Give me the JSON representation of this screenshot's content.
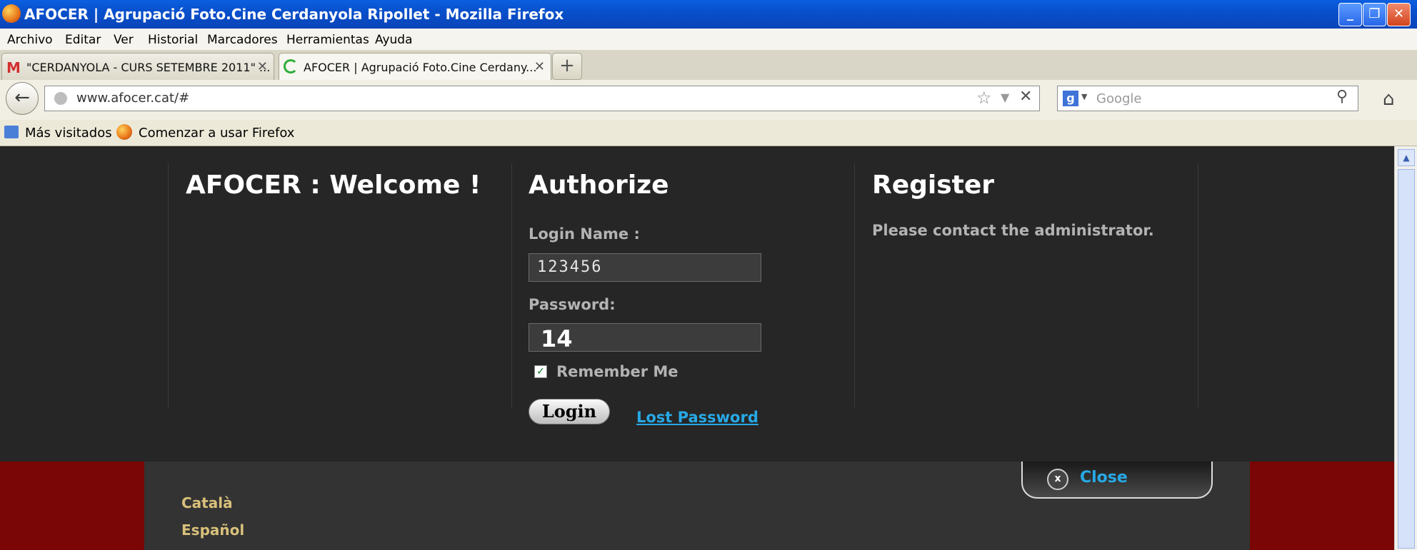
{
  "window": {
    "title": "AFOCER | Agrupació Foto.Cine Cerdanyola Ripollet - Mozilla Firefox",
    "minimize_icon": "minimize-icon",
    "restore_icon": "restore-icon",
    "close_icon": "close-icon"
  },
  "menu": [
    "Archivo",
    "Editar",
    "Ver",
    "Historial",
    "Marcadores",
    "Herramientas",
    "Ayuda"
  ],
  "tabs": [
    {
      "label": "\"CERDANYOLA - CURS SETEMBRE 2011\" ...",
      "icon": "gmail-icon"
    },
    {
      "label": "AFOCER | Agrupació Foto.Cine Cerdany...",
      "icon": "loading-icon"
    }
  ],
  "newtab_icon": "+",
  "nav": {
    "url": "www.afocer.cat/#",
    "search_placeholder": "Google"
  },
  "bookmarks": [
    {
      "label": "Más visitados",
      "icon": "bookmark-folder-icon"
    },
    {
      "label": "Comenzar a usar Firefox",
      "icon": "firefox-icon"
    }
  ],
  "page": {
    "welcome_title": "AFOCER : Welcome !",
    "authorize": {
      "title": "Authorize",
      "login_label": "Login Name :",
      "login_value": "123456",
      "password_label": "Password:",
      "password_value": "14",
      "remember_label": "Remember Me",
      "remember_checked": true,
      "login_button": "Login",
      "lost_password": "Lost Password"
    },
    "register": {
      "title": "Register",
      "message": "Please contact the administrator."
    },
    "close_label": "Close",
    "languages": [
      "Català",
      "Español"
    ]
  },
  "colors": {
    "panel_bg": "#262626",
    "link": "#27a9e6",
    "lang": "#d8c07a",
    "page_bg": "#7a0606"
  }
}
